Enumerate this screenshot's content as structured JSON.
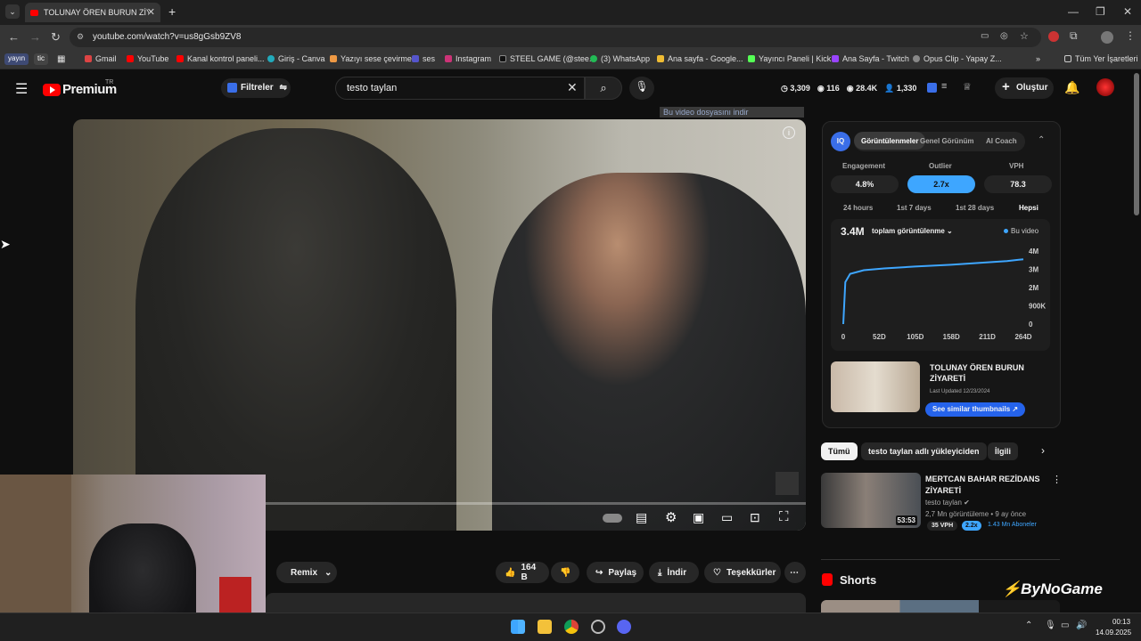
{
  "browser": {
    "tab_title": "TOLUNAY ÖREN BURUN ZİYARE",
    "url": "youtube.com/watch?v=us8gGsb9ZV8"
  },
  "bookmarks": {
    "tag1": "yayın",
    "tag2": "tic",
    "items": [
      "Gmail",
      "YouTube",
      "Kanal kontrol paneli...",
      "Giriş - Canva",
      "Yazıyı sese çevirme",
      "ses",
      "Instagram",
      "STEEL GAME (@stee...",
      "(3) WhatsApp",
      "Ana sayfa - Google...",
      "Yayıncı Paneli | Kick",
      "Ana Sayfa - Twitch",
      "Opus Clip - Yapay Z..."
    ],
    "all_bookmarks": "Tüm Yer İşaretleri"
  },
  "youtube_header": {
    "logo_text": "Premium",
    "logo_region": "TR",
    "filters_label": "Filtreler",
    "search_value": "testo taylan",
    "stats": [
      "3,309",
      "116",
      "28.4K",
      "1,330"
    ],
    "create_label": "Oluştur"
  },
  "video": {
    "download_banner": "Bu video dosyasını indir"
  },
  "actions": {
    "remix": "Remix",
    "likes": "164 B",
    "share": "Paylaş",
    "download": "İndir",
    "thanks": "Teşekkürler"
  },
  "iq_panel": {
    "tabs": [
      "Görüntülenmeler",
      "Genel Görünüm",
      "AI Coach"
    ],
    "metrics": [
      {
        "label": "Engagement",
        "value": "4.8%"
      },
      {
        "label": "Outlier",
        "value": "2.7x"
      },
      {
        "label": "VPH",
        "value": "78.3"
      }
    ],
    "ranges": [
      "24 hours",
      "1st 7 days",
      "1st 28 days",
      "Hepsi"
    ],
    "total_views": "3.4M",
    "views_dropdown": "toplam görüntülenme",
    "legend": "Bu video",
    "thumb_title": "TOLUNAY ÖREN BURUN ZİYARETİ",
    "last_updated": "Last Updated 12/23/2024",
    "similar_btn": "See similar thumbnails"
  },
  "chart_data": {
    "type": "line",
    "x_ticks": [
      "0",
      "52D",
      "105D",
      "158D",
      "211D",
      "264D"
    ],
    "y_ticks": [
      "4M",
      "3M",
      "2M",
      "900K",
      "0"
    ],
    "series": [
      {
        "name": "Bu video",
        "x": [
          0,
          3,
          10,
          30,
          60,
          105,
          158,
          200,
          240,
          264
        ],
        "y": [
          0,
          2300000,
          2750000,
          2950000,
          3050000,
          3150000,
          3250000,
          3350000,
          3450000,
          3550000
        ]
      }
    ],
    "xlim": [
      0,
      264
    ],
    "ylim": [
      0,
      4000000
    ]
  },
  "chips": [
    "Tümü",
    "testo taylan adlı yükleyiciden",
    "İlgili"
  ],
  "recommendation": {
    "title": "MERTCAN BAHAR REZİDANS ZİYARETİ",
    "channel": "testo taylan",
    "meta": "2,7 Mn görüntüleme • 9 ay önce",
    "duration": "53:53",
    "vph": "35 VPH",
    "outlier": "2.2x",
    "subs": "1.43 Mn Aboneler"
  },
  "shorts_title": "Shorts",
  "watermark": "ByNoGame",
  "clock": {
    "time": "00:13",
    "date": "14.09.2025"
  }
}
